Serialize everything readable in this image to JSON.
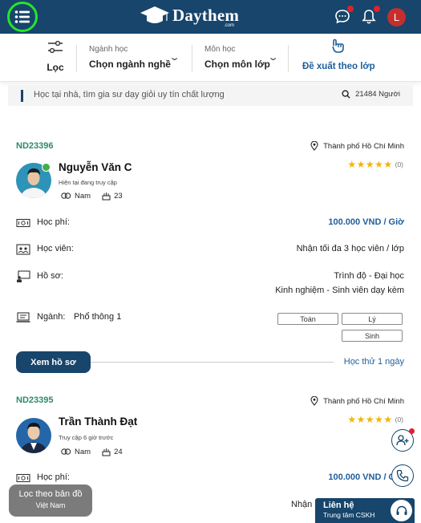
{
  "header": {
    "logo_text": "Daythem",
    "logo_sub": ".com",
    "icons": [
      "menu-icon",
      "chat-icon",
      "bell-icon"
    ],
    "user_initial": "L",
    "accent_color": "#17456b"
  },
  "filters": {
    "filter_label": "Lọc",
    "major": {
      "label": "Ngành học",
      "value": "Chọn ngành nghề"
    },
    "subject": {
      "label": "Môn học",
      "value": "Chọn môn lớp"
    },
    "suggest_label": "Đề xuất theo lớp"
  },
  "search": {
    "placeholder": "Học tại nhà, tìm gia sư dạy giỏi uy tín chất lượng",
    "count": "21484 Người"
  },
  "tutors": [
    {
      "id": "ND23396",
      "location": "Thành phố Hồ Chí Minh",
      "name": "Nguyễn Văn C",
      "status": "Hiện tại đang truy cập",
      "gender": "Nam",
      "age": "23",
      "stars": "★★★★★",
      "rating_count": "(0)",
      "fee_label": "Học phí:",
      "fee": "100.000 VND / Giờ",
      "students_label": "Học viên:",
      "students": "Nhận tối đa 3 học viên / lớp",
      "profile_label": "Hồ sơ:",
      "level": "Trình độ - Đại học",
      "experience": "Kinh nghiệm - Sinh viên dạy kèm",
      "major_label": "Ngành:",
      "major": "Phổ thông 1",
      "subjects": [
        "Toán",
        "Lý",
        "Sinh"
      ],
      "view_button": "Xem hồ sơ",
      "first_lesson": "Học thử 1 ngày"
    },
    {
      "id": "ND23395",
      "location": "Thành phố Hồ Chí Minh",
      "name": "Trần Thành Đạt",
      "status": "Truy cập 6 giờ trước",
      "gender": "Nam",
      "age": "24",
      "stars": "★★★★★",
      "rating_count": "(0)",
      "fee_label": "Học phí:",
      "fee": "100.000 VND / Giờ",
      "students_partial": "Nhận"
    }
  ],
  "map_filter": {
    "title": "Lọc theo bản đồ",
    "subtitle": "Việt Nam"
  },
  "contact": {
    "title": "Liên hệ",
    "subtitle": "Trung tâm CSKH"
  }
}
